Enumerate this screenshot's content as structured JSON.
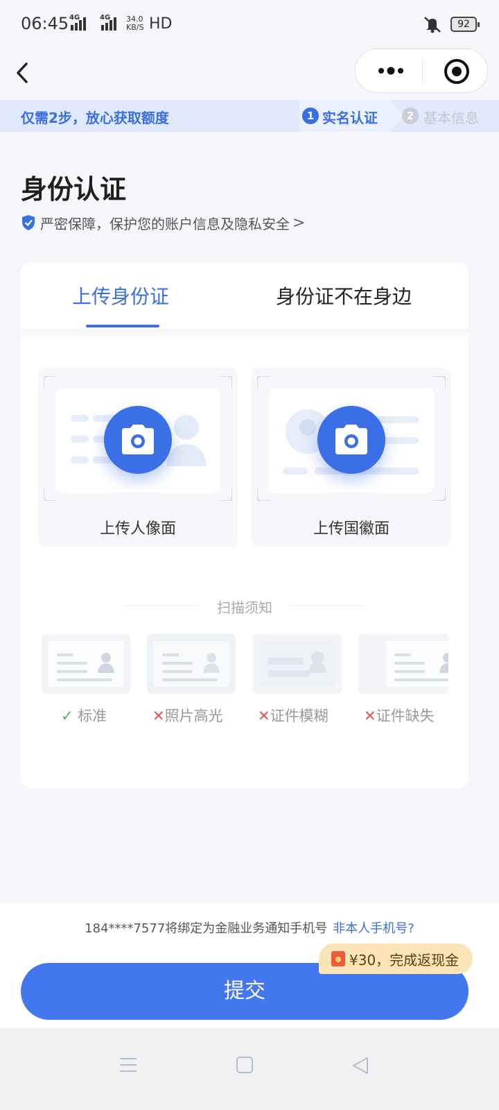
{
  "status_bar": {
    "time": "06:45",
    "signal1": "4G",
    "signal2": "4G",
    "speed_value": "34.0",
    "speed_unit": "KB/S",
    "hd": "HD",
    "battery": "92"
  },
  "steps": {
    "tip": "仅需2步，放心获取额度",
    "step1_num": "1",
    "step1_label": "实名认证",
    "step2_num": "2",
    "step2_label": "基本信息",
    "active_color": "#3a6fe0",
    "inactive_color": "#c2c7d0"
  },
  "page": {
    "title": "身份认证",
    "privacy": "严密保障，保护您的账户信息及隐私安全",
    "privacy_chevron": ">"
  },
  "tabs": {
    "upload_id": "上传身份证",
    "no_id": "身份证不在身边",
    "selected": "upload_id"
  },
  "uploads": {
    "portrait": "上传人像面",
    "emblem": "上传国徽面"
  },
  "notice": {
    "title": "扫描须知",
    "items": [
      {
        "mark": "✓",
        "label": "标准",
        "ok": true
      },
      {
        "mark": "✕",
        "label": "照片高光",
        "ok": false
      },
      {
        "mark": "✕",
        "label": "证件模糊",
        "ok": false
      },
      {
        "mark": "✕",
        "label": "证件缺失",
        "ok": false
      }
    ]
  },
  "bottom": {
    "phone_text": "184****7577将绑定为金融业务通知手机号",
    "phone_link": "非本人手机号?",
    "promo": "¥30，完成返现金",
    "submit": "提交"
  },
  "colors": {
    "accent": "#3a6fe0",
    "button": "#4277f0",
    "promo_bg": "#fbe5b6"
  }
}
